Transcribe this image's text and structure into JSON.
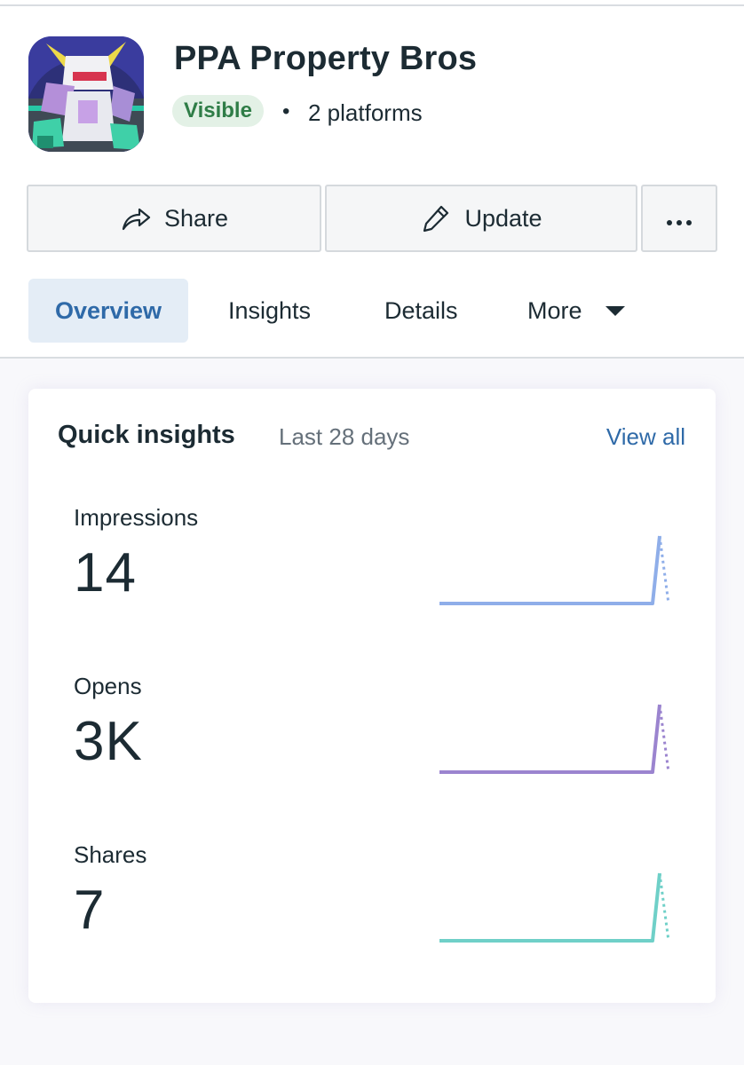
{
  "app": {
    "title": "PPA Property Bros",
    "status_badge": "Visible",
    "separator": "•",
    "platforms": "2 platforms",
    "icon": "robot-mech-game-icon"
  },
  "actions": {
    "share_label": "Share",
    "share_icon": "share-arrow-icon",
    "update_label": "Update",
    "update_icon": "pencil-icon",
    "more_icon": "ellipsis-icon"
  },
  "tabs": [
    {
      "label": "Overview",
      "active": true
    },
    {
      "label": "Insights",
      "active": false
    },
    {
      "label": "Details",
      "active": false
    },
    {
      "label": "More",
      "active": false
    }
  ],
  "quick_insights": {
    "title": "Quick insights",
    "range": "Last 28 days",
    "view_all": "View all",
    "metrics": [
      {
        "label": "Impressions",
        "value": "14",
        "color": "#8faee9"
      },
      {
        "label": "Opens",
        "value": "3K",
        "color": "#9b84cf"
      },
      {
        "label": "Shares",
        "value": "7",
        "color": "#6fd0c8"
      }
    ]
  },
  "colors": {
    "accent_blue": "#2f6aa8",
    "badge_green_text": "#2f7d47",
    "badge_green_bg": "#e3f1e6",
    "active_tab_bg": "#e4edf6"
  }
}
